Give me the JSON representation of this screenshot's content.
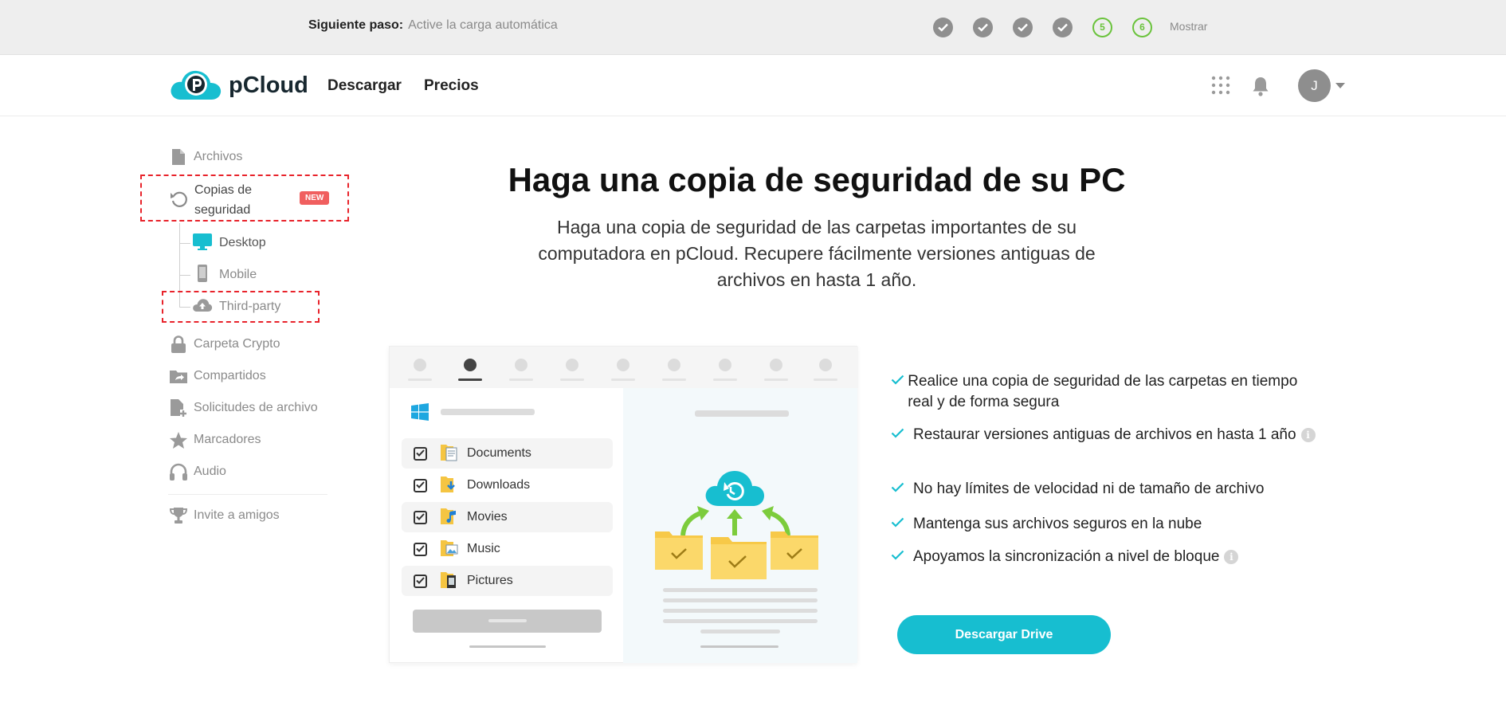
{
  "banner": {
    "label": "Siguiente paso:",
    "text": "Active la carga automática",
    "steps": [
      "5",
      "6"
    ],
    "show": "Mostrar"
  },
  "nav": {
    "brand": "pCloud",
    "links": [
      "Descargar",
      "Precios"
    ],
    "avatar_initial": "J"
  },
  "sidebar": {
    "items": [
      "Archivos",
      "Copias de seguridad",
      "Carpeta Crypto",
      "Compartidos",
      "Solicitudes de archivo",
      "Marcadores",
      "Audio",
      "Invite a amigos"
    ],
    "new_badge": "NEW",
    "sub_items": [
      "Desktop",
      "Mobile",
      "Third-party"
    ]
  },
  "hero": {
    "title": "Haga una copia de seguridad de su PC",
    "subtitle": "Haga una copia de seguridad de las carpetas importantes de su computadora en pCloud. Recupere fácilmente versiones antiguas de archivos en hasta 1 año."
  },
  "illustration": {
    "folders": [
      "Documents",
      "Downloads",
      "Movies",
      "Music",
      "Pictures"
    ]
  },
  "features": [
    "Realice una copia de seguridad de las carpetas en tiempo real y de forma segura",
    "Restaurar versiones antiguas de archivos en hasta 1 año",
    "No hay límites de velocidad ni de tamaño de archivo",
    "Mantenga sus archivos seguros en la nube",
    "Apoyamos la sincronización a nivel de bloque"
  ],
  "info_glyph": "i",
  "cta": "Descargar Drive",
  "colors": {
    "accent": "#17bed0",
    "step_done": "#8f8f8f",
    "step_pending": "#6ac33c",
    "highlight": "#e8232b",
    "badge": "#f05f5f"
  }
}
